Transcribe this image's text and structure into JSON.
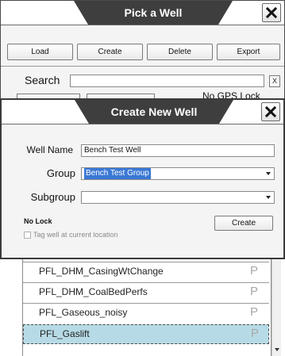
{
  "pick_dialog": {
    "title": "Pick a Well",
    "buttons": {
      "load": "Load",
      "create": "Create",
      "delete": "Delete",
      "export": "Export"
    },
    "search_label": "Search",
    "search_value": "",
    "clear_label": "X",
    "peek_text": "No GPS Lock"
  },
  "create_dialog": {
    "title": "Create New Well",
    "well_name_label": "Well Name",
    "well_name_value": "Bench Test Well",
    "group_label": "Group",
    "group_value": "Bench Test Group",
    "subgroup_label": "Subgroup",
    "subgroup_value": "",
    "lock_status": "No Lock",
    "tag_label": "Tag well at current location",
    "tag_checked": false,
    "create_button": "Create"
  },
  "well_list": {
    "rows": [
      {
        "name": "PFL_DHM_CasingWtChange",
        "flag": "P",
        "selected": false
      },
      {
        "name": "PFL_DHM_CoalBedPerfs",
        "flag": "P",
        "selected": false
      },
      {
        "name": "PFL_Gaseous_noisy",
        "flag": "P",
        "selected": false
      },
      {
        "name": "PFL_Gaslift",
        "flag": "P",
        "selected": true
      }
    ]
  },
  "colors": {
    "title_tab": "#3e3e3e",
    "selection": "#3a78d6",
    "selected_row": "#b7dbe6"
  }
}
